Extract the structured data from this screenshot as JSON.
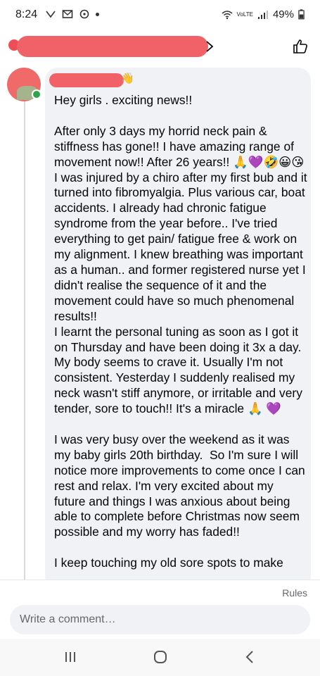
{
  "status_bar": {
    "time": "8:24",
    "network": "VoLTE",
    "battery": "49%",
    "icons": [
      "cast-icon",
      "mail-icon",
      "messenger-icon",
      "wifi-icon",
      "signal-icon",
      "battery-icon"
    ]
  },
  "post_header": {
    "icons": [
      "chevron-right-icon",
      "like-icon"
    ]
  },
  "comment": {
    "name_emoji": "👋",
    "text": "Hey girls . exciting news!!\n\nAfter only 3 days my horrid neck pain & stiffness has gone!! I have amazing range of movement now!! After 26 years!! 🙏💜🤣😀😘 I was injured by a chiro after my first bub and it turned into fibromyalgia. Plus various car, boat accidents. I already had chronic fatigue syndrome from the year before.. I've tried everything to get pain/ fatigue free & work on my alignment. I knew breathing was important as a human.. and former registered nurse yet I didn't realise the sequence of it and the movement could have so much phenomenal results!!\nI learnt the personal tuning as soon as I got it on Thursday and have been doing it 3x a day. My body seems to crave it. Usually I'm not consistent. Yesterday I suddenly realised my neck wasn't stiff anymore, or irritable and very tender, sore to touch!! It's a miracle 🙏 💜\n\nI was very busy over the weekend as it was my baby girls 20th birthday.  So I'm sure I will notice more improvements to come once I can rest and relax. I'm very excited about my future and things I was anxious about being able to complete before Christmas now seem possible and my worry has faded!!\n\nI keep touching my old sore spots to make"
  },
  "footer": {
    "rules_label": "Rules",
    "comment_placeholder": "Write a comment…"
  },
  "nav": {
    "icons": [
      "recent-apps-icon",
      "home-icon",
      "back-icon"
    ]
  },
  "colors": {
    "redaction": "#f06267",
    "bubble": "#f0f2f5",
    "online": "#31a24c"
  }
}
